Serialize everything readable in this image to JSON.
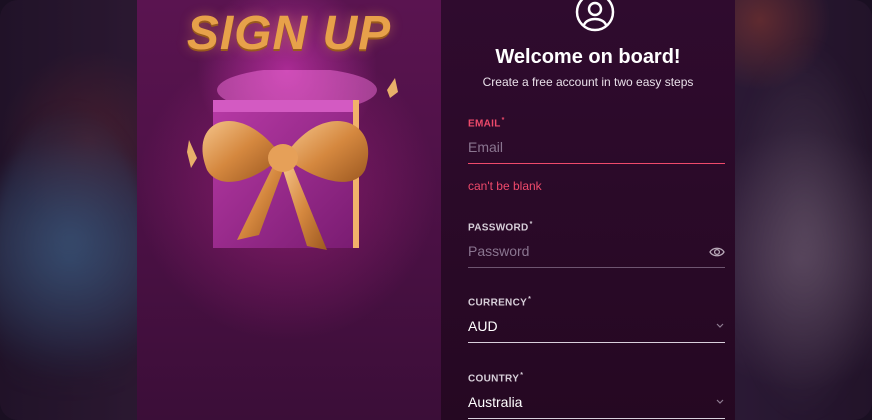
{
  "promo": {
    "title": "SIGN UP"
  },
  "form": {
    "heading": "Welcome on board!",
    "subheading": "Create a free account in two easy steps",
    "email": {
      "label": "EMAIL",
      "required_mark": "*",
      "placeholder": "Email",
      "value": "",
      "error": "can't be blank"
    },
    "password": {
      "label": "PASSWORD",
      "required_mark": "*",
      "placeholder": "Password",
      "value": ""
    },
    "currency": {
      "label": "CURRENCY",
      "required_mark": "*",
      "value": "AUD"
    },
    "country": {
      "label": "COUNTRY",
      "required_mark": "*",
      "value": "Australia"
    }
  },
  "colors": {
    "error": "#ef4a6b",
    "promo_gold": "#e7a14a",
    "modal_bg": "#2f0b2e"
  },
  "icons": [
    "user-circle-icon",
    "eye-icon",
    "chevron-down-icon",
    "gift-icon"
  ]
}
